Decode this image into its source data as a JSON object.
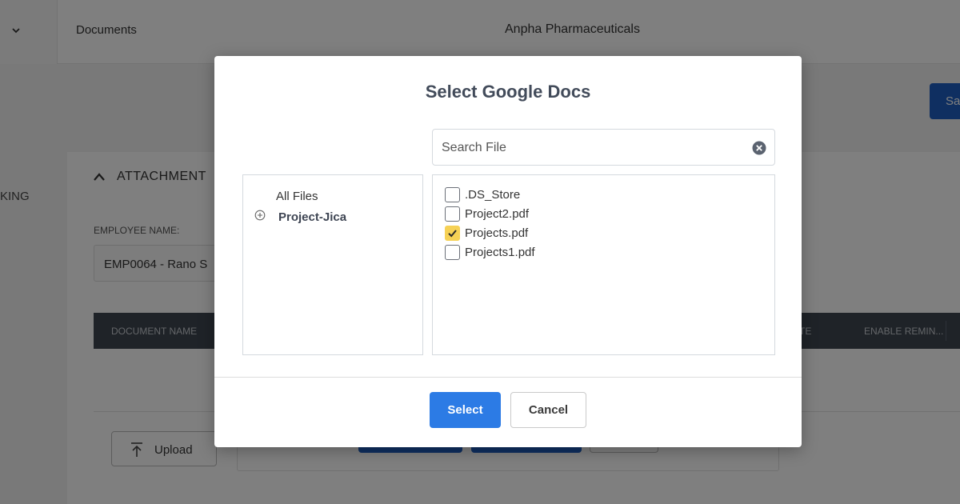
{
  "background": {
    "breadcrumb": "Documents",
    "company_name": "Anpha Pharmaceuticals",
    "save_button_label": "Sa",
    "sidebar_text": "KING",
    "attachments_header": "ATTACHMENT",
    "employee_label": "EMPLOYEE NAME:",
    "employee_value": "EMP0064 - Rano S",
    "table_columns": [
      "DOCUMENT NAME",
      "TE",
      "ENABLE REMIN..."
    ],
    "upload_label": "Upload"
  },
  "modal": {
    "title": "Select Google Docs",
    "search": {
      "placeholder": "Search File",
      "value": ""
    },
    "tree": {
      "root_label": "All Files",
      "folders": [
        {
          "label": "Project-Jica",
          "icon": "plus-circle-icon"
        }
      ]
    },
    "files": [
      {
        "name": ".DS_Store",
        "checked": false
      },
      {
        "name": "Project2.pdf",
        "checked": false
      },
      {
        "name": "Projects.pdf",
        "checked": true
      },
      {
        "name": "Projects1.pdf",
        "checked": false
      }
    ],
    "select_label": "Select",
    "cancel_label": "Cancel"
  },
  "colors": {
    "primary": "#2c7be5",
    "checkbox_checked": "#f6d155",
    "table_header": "#3e4650"
  }
}
